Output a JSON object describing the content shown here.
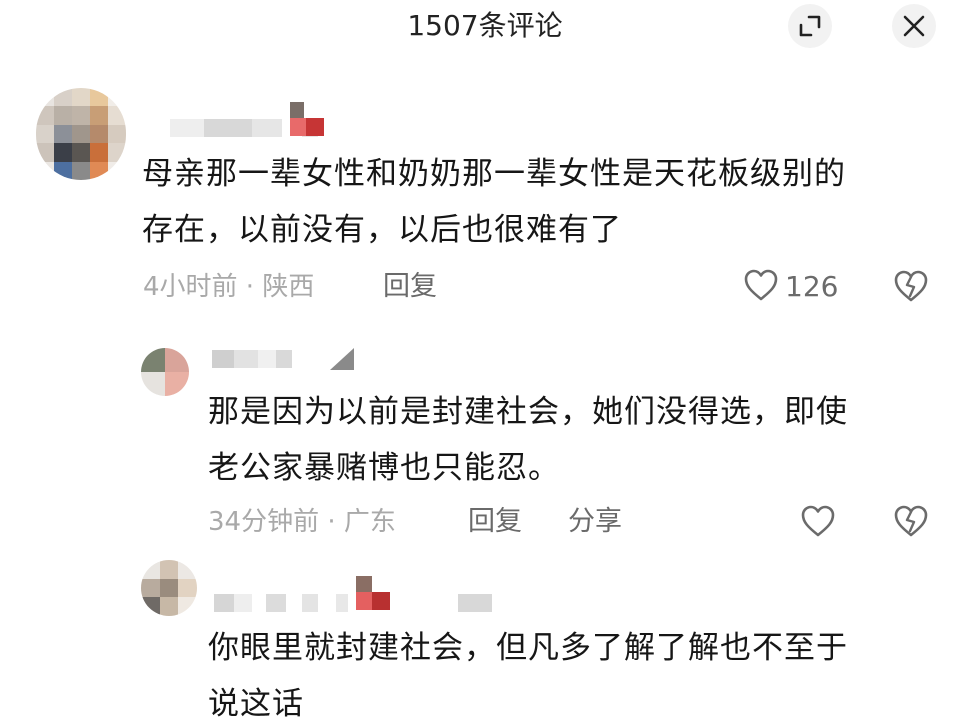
{
  "header": {
    "title": "1507条评论",
    "expand_icon": "expand-icon",
    "close_icon": "close-icon"
  },
  "comments": [
    {
      "text_line1": "母亲那一辈女性和奶奶那一辈女性是天花板级别的",
      "text_line2": "存在，以前没有，以后也很难有了",
      "meta": "4小时前 · 陕西",
      "reply_label": "回复",
      "like_count": "126",
      "like_icon": "heart-icon",
      "dislike_icon": "broken-heart-icon"
    },
    {
      "text_line1": "那是因为以前是封建社会，她们没得选，即使",
      "text_line2": "老公家暴赌博也只能忍。",
      "meta": "34分钟前 · 广东",
      "reply_label": "回复",
      "share_label": "分享",
      "like_icon": "heart-icon",
      "dislike_icon": "broken-heart-icon"
    },
    {
      "text_line1": "你眼里就封建社会，但凡多了解了解也不至于",
      "text_line2": "说这话"
    }
  ],
  "colors": {
    "text": "#161616",
    "meta": "#a9a9a9",
    "action": "#6a6a6a"
  }
}
